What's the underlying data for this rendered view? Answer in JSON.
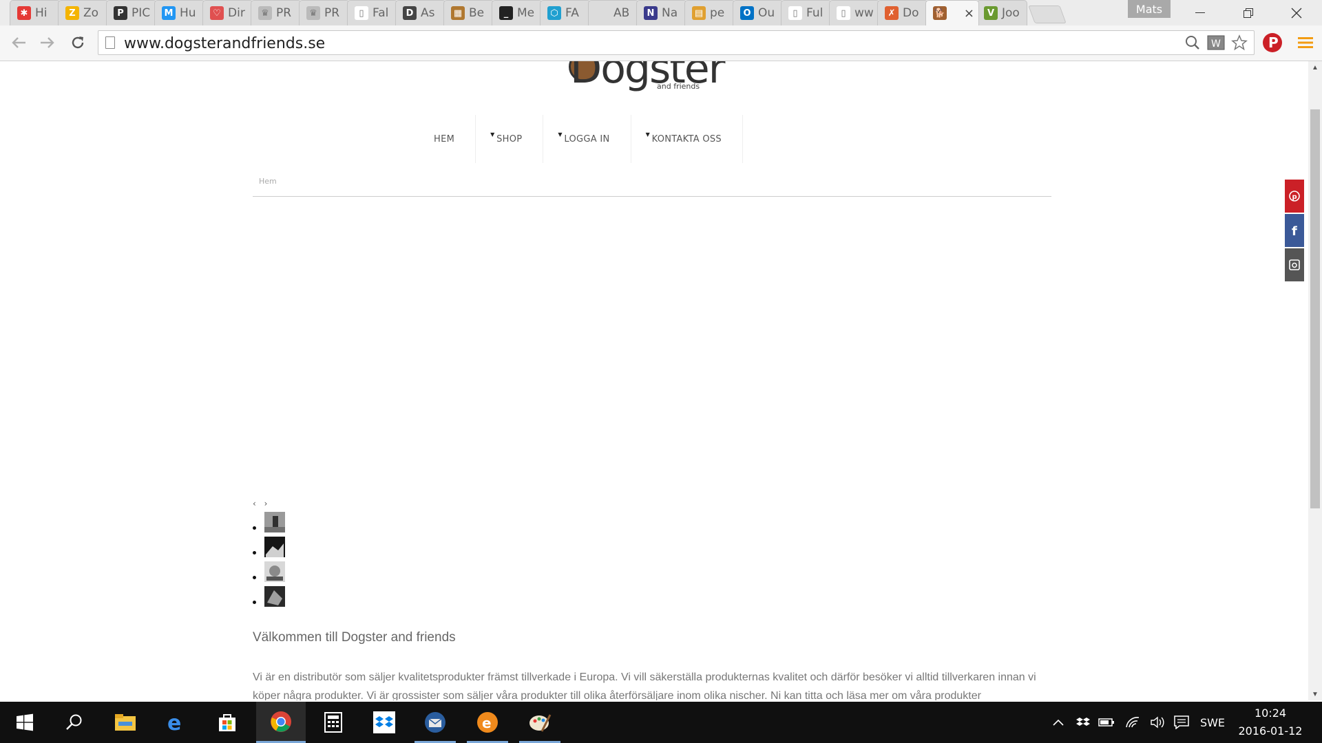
{
  "browser": {
    "tabs": [
      {
        "title": "Hi",
        "favicon": "asterisk-icon",
        "color": "#e53935",
        "glyph": "✱"
      },
      {
        "title": "Zo",
        "favicon": "zoho-icon",
        "color": "#f4b400",
        "glyph": "Z"
      },
      {
        "title": "PIC",
        "favicon": "pinterest-icon",
        "color": "#333333",
        "glyph": "P"
      },
      {
        "title": "Hu",
        "favicon": "chart-icon",
        "color": "#2196f3",
        "glyph": "M"
      },
      {
        "title": "Dir",
        "favicon": "heart-icon",
        "color": "#e05050",
        "glyph": "♡"
      },
      {
        "title": "PR",
        "favicon": "crown-icon",
        "color": "#bbbbbb",
        "glyph": "♛"
      },
      {
        "title": "PR",
        "favicon": "crown-icon",
        "color": "#bbbbbb",
        "glyph": "♛"
      },
      {
        "title": "Fal",
        "favicon": "document-icon",
        "color": "#ffffff",
        "glyph": "▯"
      },
      {
        "title": "As",
        "favicon": "dm-icon",
        "color": "#444444",
        "glyph": "D"
      },
      {
        "title": "Be",
        "favicon": "pattern-icon",
        "color": "#b07830",
        "glyph": "▦"
      },
      {
        "title": "Me",
        "favicon": "terminal-icon",
        "color": "#222222",
        "glyph": "_"
      },
      {
        "title": "FA",
        "favicon": "hexagon-icon",
        "color": "#20a0d0",
        "glyph": "⬡"
      },
      {
        "title": "AB",
        "favicon": "blank-icon",
        "color": "#dcdcdc",
        "glyph": ""
      },
      {
        "title": "Na",
        "favicon": "n-icon",
        "color": "#3a3a8c",
        "glyph": "N"
      },
      {
        "title": "pe",
        "favicon": "grid-icon",
        "color": "#e0a030",
        "glyph": "▤"
      },
      {
        "title": "Ou",
        "favicon": "outlook-icon",
        "color": "#0072c6",
        "glyph": "O"
      },
      {
        "title": "Ful",
        "favicon": "document-icon",
        "color": "#ffffff",
        "glyph": "▯"
      },
      {
        "title": "ww",
        "favicon": "document-icon",
        "color": "#ffffff",
        "glyph": "▯"
      },
      {
        "title": "Do",
        "favicon": "colorful-icon",
        "color": "#e06030",
        "glyph": "✗"
      },
      {
        "title": "",
        "favicon": "dog-icon",
        "color": "#a06030",
        "glyph": "🐕",
        "active": true
      },
      {
        "title": "Joo",
        "favicon": "v-icon",
        "color": "#6a9a30",
        "glyph": "V"
      }
    ],
    "profile_name": "Mats",
    "url": "www.dogsterandfriends.se",
    "close_tab_glyph": "×"
  },
  "page": {
    "logo_text": "Dogster",
    "logo_sub": "and friends",
    "nav": [
      {
        "label": "HEM",
        "has_caret": false
      },
      {
        "label": "SHOP",
        "has_caret": true
      },
      {
        "label": "LOGGA IN",
        "has_caret": true
      },
      {
        "label": "KONTAKTA OSS",
        "has_caret": true
      }
    ],
    "breadcrumb": "Hem",
    "slider_prev": "‹",
    "slider_next": "›",
    "thumbnails": 4,
    "welcome_heading": "Välkommen till Dogster and friends",
    "intro_text": "Vi är en distributör som säljer kvalitetsprodukter främst tillverkade i Europa. Vi vill säkerställa produkternas kvalitet och därför besöker vi alltid tillverkaren innan vi köper några produkter. Vi är grossister som säljer våra produkter till olika återförsäljare inom olika nischer. Ni kan titta och läsa mer om våra produkter",
    "social": [
      {
        "name": "pinterest",
        "glyph": "℗",
        "color": "#cb2027"
      },
      {
        "name": "facebook",
        "glyph": "f",
        "color": "#3b5998"
      },
      {
        "name": "instagram",
        "glyph": "◙",
        "color": "#555555"
      }
    ]
  },
  "taskbar": {
    "language": "SWE",
    "time": "10:24",
    "date": "2016-01-12"
  }
}
